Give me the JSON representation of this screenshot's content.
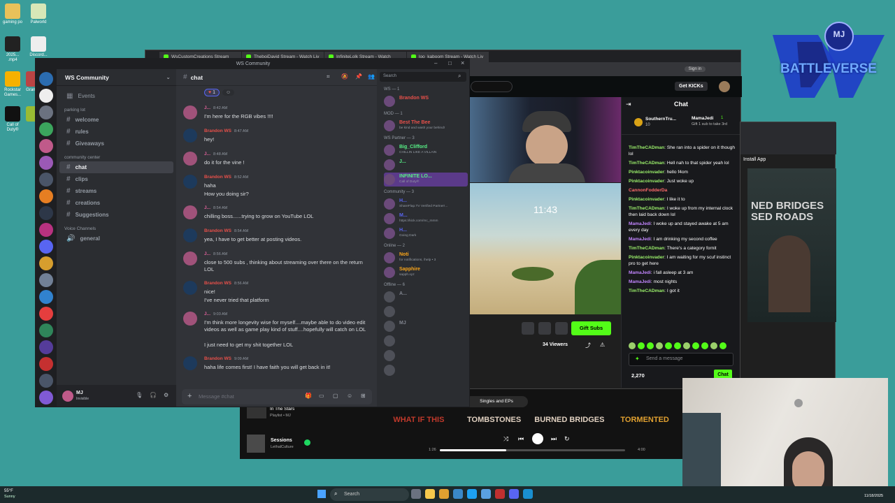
{
  "desktop": {
    "icons": [
      {
        "label": "gaming po",
        "color": "#e8c15a"
      },
      {
        "label": "Palworld",
        "color": "#d8e7b7"
      },
      {
        "label": "2025... .mp4",
        "color": "#222"
      },
      {
        "label": "Discord...",
        "color": "#eee"
      },
      {
        "label": "Rockstar Games...",
        "color": "#f6b100"
      },
      {
        "label": "Grand...",
        "color": "#b44"
      },
      {
        "label": "Call of Duty®",
        "color": "#111"
      },
      {
        "label": "",
        "color": "#9b3"
      }
    ],
    "logo_text": "BATTLEVERSE",
    "logo_badge": "MJ"
  },
  "browser": {
    "tabs": [
      "WsCustomCreations Stream",
      "TheboiDavid Stream - Watch Liv",
      "InfiniteLolk Stream - Watch",
      "loo_kaboom Stream - Watch Liv"
    ],
    "sign_in": "Sign in",
    "get_kicks": "Get KICKs",
    "chat_header": "Chat",
    "gift_subs": "Gift Subs",
    "viewers": "34 Viewers",
    "pinned": {
      "user": "SouthernTru...",
      "count": "10",
      "user2": "MamaJedi",
      "count2": "1",
      "note": "Gift 1 sub to take 3rd"
    },
    "chat_messages": [
      {
        "user": "TimTheCADman",
        "text": "She ran into a spider on it though lol",
        "color": "#9bf06b"
      },
      {
        "user": "TimTheCADman",
        "text": "Hell nah to that spider yeah lol",
        "color": "#9bf06b"
      },
      {
        "user": "Pinktacoinvader",
        "text": "hello f4om",
        "color": "#9bf06b"
      },
      {
        "user": "Pinktacoinvader",
        "text": "Just woke up",
        "color": "#9bf06b"
      },
      {
        "user": "CannonFodderDa",
        "text": "",
        "color": "#ff6b6b"
      },
      {
        "user": "Pinktacoinvader",
        "text": "I like it to",
        "color": "#9bf06b"
      },
      {
        "user": "TimTheCADman",
        "text": "I woke up from my internal clock then laid back down lol",
        "color": "#9bf06b"
      },
      {
        "user": "MamaJedi",
        "text": "I woke up and stayed awake at 5 am every day",
        "color": "#c084fc"
      },
      {
        "user": "MamaJedi",
        "text": "I am drinking my second coffee",
        "color": "#c084fc"
      },
      {
        "user": "TimTheCADman",
        "text": "There's a category fornit",
        "color": "#9bf06b"
      },
      {
        "user": "Pinktacoinvader",
        "text": "I am waiting for my scuf instinct pro to get here",
        "color": "#9bf06b"
      },
      {
        "user": "MamaJedi",
        "text": "i fall asleep at 3 am",
        "color": "#c084fc"
      },
      {
        "user": "MamaJedi",
        "text": "most nights",
        "color": "#c084fc"
      },
      {
        "user": "TimTheCADman",
        "text": "I got it",
        "color": "#9bf06b"
      }
    ],
    "send_placeholder": "Send a message",
    "points": "2,270",
    "chat_button": "Chat",
    "desktop_clock": "11:43",
    "install_app": "Install App"
  },
  "spotify": {
    "playlist": "In The Stars",
    "playlist_sub": "Playlist • MJ",
    "track": "Sessions",
    "artist": "LethalCulture",
    "elapsed": "1:26",
    "duration": "4:00",
    "progress": 0.36,
    "section": "Singles and EPs",
    "albums": [
      "WHAT IF THIS",
      "TOMBSTONES",
      "BURNED BRIDGES",
      "TORMENTED"
    ],
    "poster_text": "NED BRIDGES\nSED ROADS"
  },
  "discord": {
    "window_title": "WS Community",
    "server_name": "WS Community",
    "channel": "chat",
    "search_placeholder": "Search",
    "events": "Events",
    "categories": [
      {
        "name": "parking lot",
        "channels": [
          "welcome",
          "rules",
          "Giveaways"
        ]
      },
      {
        "name": "community center",
        "channels": [
          "chat",
          "clips",
          "streams",
          "creations",
          "Suggestions"
        ]
      },
      {
        "name": "Voice Channels",
        "channels": [
          "general"
        ]
      }
    ],
    "reaction_count": "1",
    "messages": [
      {
        "user": "J...",
        "color": "#e0609a",
        "time": "8:42 AM",
        "lines": [
          "I'm here for the RGB vibes !!!!"
        ]
      },
      {
        "user": "Brandon WS",
        "color": "#e8504a",
        "time": "8:47 AM",
        "lines": [
          "hey!"
        ]
      },
      {
        "user": "J...",
        "color": "#e0609a",
        "time": "8:48 AM",
        "lines": [
          "do it for the vine !"
        ]
      },
      {
        "user": "Brandon WS",
        "color": "#e8504a",
        "time": "8:52 AM",
        "lines": [
          "haha",
          "How you doing sir?"
        ]
      },
      {
        "user": "J...",
        "color": "#e0609a",
        "time": "8:54 AM",
        "lines": [
          "chilling boss......trying to grow on YouTube LOL"
        ]
      },
      {
        "user": "Brandon WS",
        "color": "#e8504a",
        "time": "8:54 AM",
        "lines": [
          "yea, I have to get better at posting videos."
        ]
      },
      {
        "user": "J...",
        "color": "#e0609a",
        "time": "8:56 AM",
        "lines": [
          "close to 500 subs , thinking about streaming over there on the return LOL"
        ]
      },
      {
        "user": "Brandon WS",
        "color": "#e8504a",
        "time": "8:56 AM",
        "lines": [
          "nice!",
          "I've never tried that platform"
        ]
      },
      {
        "user": "J...",
        "color": "#e0609a",
        "time": "9:03 AM",
        "lines": [
          "I'm think more longevity wise for myself....maybe able to do video edit videos as well as game play kind of stuff....hopefully will catch on LOL",
          "I just need to get my shit together LOL"
        ]
      },
      {
        "user": "Brandon WS",
        "color": "#e8504a",
        "time": "9:09 AM",
        "lines": [
          "haha life comes first! I have faith you will get back in it!"
        ]
      }
    ],
    "message_placeholder": "Message #chat",
    "user": {
      "name": "MJ",
      "status": "Invisible"
    },
    "member_sections": [
      {
        "title": "WS — 1",
        "members": [
          {
            "name": "Brandon WS",
            "status": "",
            "color": "#e8504a"
          }
        ]
      },
      {
        "title": "MOD — 1",
        "members": [
          {
            "name": "Best The Bee",
            "status": "be kind and wash your behind!",
            "color": "#e8504a"
          }
        ]
      },
      {
        "title": "WS Partner — 3",
        "members": [
          {
            "name": "Big_Clifford",
            "status": "CHILLIN LIKE A VILLAIN",
            "color": "#57f287"
          },
          {
            "name": "J...",
            "status": "",
            "color": "#57f287"
          },
          {
            "name": "INFINITE LO...",
            "status": "Call of Duty®",
            "color": "#57f287"
          }
        ]
      },
      {
        "title": "Community — 3",
        "members": [
          {
            "name": "H...",
            "status": "ShareFlap.TV Verified Partner!...",
            "color": "#5865f2"
          },
          {
            "name": "M...",
            "status": "https://kick.com/mc_mmm",
            "color": "#5865f2"
          },
          {
            "name": "H...",
            "status": "Going Dark",
            "color": "#5865f2"
          }
        ]
      },
      {
        "title": "Online — 2",
        "members": [
          {
            "name": "Noti",
            "status": "for notifications, /help • 3",
            "color": "#faa61a"
          },
          {
            "name": "Sapphire",
            "status": "sapph.xyz",
            "color": "#faa61a"
          }
        ]
      },
      {
        "title": "Offline — 6",
        "members": [
          {
            "name": "A...",
            "status": "",
            "color": "#80848e"
          },
          {
            "name": "",
            "status": "",
            "color": "#80848e"
          },
          {
            "name": "MJ",
            "status": "",
            "color": "#80848e"
          },
          {
            "name": "",
            "status": "",
            "color": "#80848e"
          },
          {
            "name": "",
            "status": "",
            "color": "#80848e"
          },
          {
            "name": "",
            "status": "",
            "color": "#80848e"
          }
        ]
      }
    ]
  },
  "taskbar": {
    "weather": "55°F",
    "weather_sub": "Sunny",
    "search": "Search",
    "date": "11/18/2025"
  }
}
